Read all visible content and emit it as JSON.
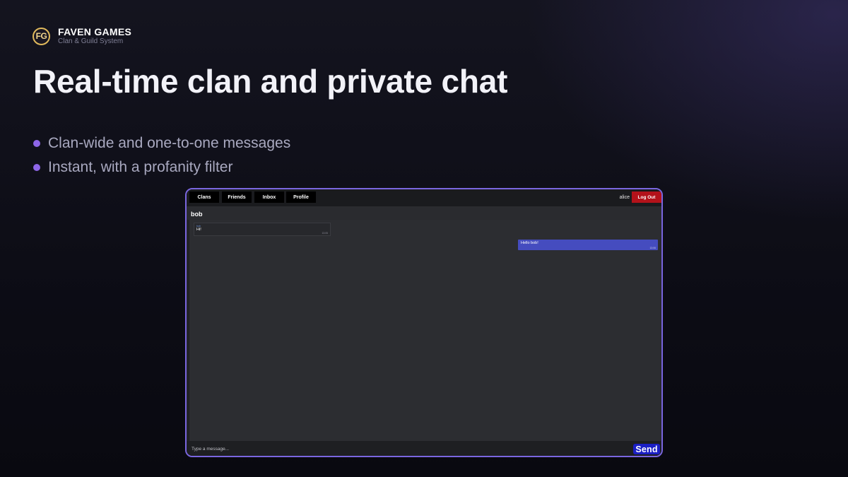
{
  "brand": {
    "logo_text": "FG",
    "name": "FAVEN GAMES",
    "subtitle": "Clan & Guild System",
    "logo_color": "#e0b95c"
  },
  "headline": "Real-time clan and private chat",
  "bullets": [
    "Clan-wide and one-to-one messages",
    "Instant, with a profanity filter"
  ],
  "app": {
    "nav": {
      "items": [
        "Clans",
        "Friends",
        "Inbox",
        "Profile"
      ],
      "username": "alice",
      "logout_label": "Log Out"
    },
    "chat": {
      "title": "bob",
      "messages": [
        {
          "sender": "bob",
          "text": "Hi!",
          "time": "13:05",
          "direction": "incoming"
        },
        {
          "text": "Hello bob!",
          "time": "13:06",
          "direction": "outgoing"
        }
      ]
    },
    "composer": {
      "placeholder": "Type a message...",
      "send_label": "Send"
    },
    "colors": {
      "frame": "#7a66e0",
      "logout": "#b3121a",
      "outgoing_bubble": "#454cbf",
      "send": "#1b1fc4",
      "bullet": "#8e66e8"
    }
  }
}
